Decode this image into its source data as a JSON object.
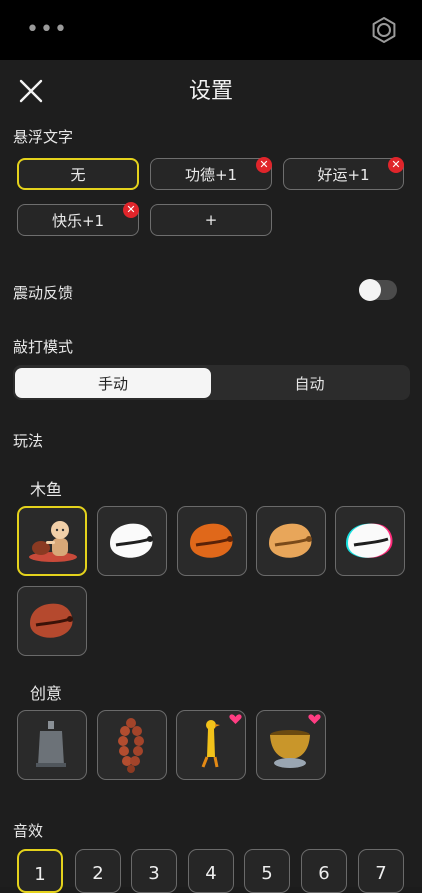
{
  "status_bar": {
    "more_label": "•••"
  },
  "header": {
    "title": "设置"
  },
  "floating_text": {
    "label": "悬浮文字",
    "options": [
      {
        "label": "无",
        "selected": true,
        "removable": false
      },
      {
        "label": "功德+1",
        "selected": false,
        "removable": true
      },
      {
        "label": "好运+1",
        "selected": false,
        "removable": true
      },
      {
        "label": "快乐+1",
        "selected": false,
        "removable": true
      },
      {
        "label": "+",
        "selected": false,
        "removable": false
      }
    ]
  },
  "vibration": {
    "label": "震动反馈",
    "enabled": false
  },
  "tap_mode": {
    "label": "敲打模式",
    "options": [
      "手动",
      "自动"
    ],
    "selected": "手动"
  },
  "gameplay": {
    "label": "玩法",
    "muyu": {
      "label": "木鱼",
      "items": [
        "monk-woodfish",
        "white-woodfish",
        "orange-woodfish",
        "tan-woodfish",
        "glitch-woodfish",
        "red-woodfish"
      ],
      "selected": 0
    },
    "creative": {
      "label": "创意",
      "items": [
        "bell",
        "prayer-beads",
        "rubber-chicken",
        "singing-bowl"
      ]
    }
  },
  "sound": {
    "label": "音效",
    "options": [
      "1",
      "2",
      "3",
      "4",
      "5",
      "6",
      "7"
    ],
    "selected": "1"
  },
  "colors": {
    "accent": "#e4d21c",
    "badge": "#e0252b",
    "background": "#1e1e1e"
  }
}
